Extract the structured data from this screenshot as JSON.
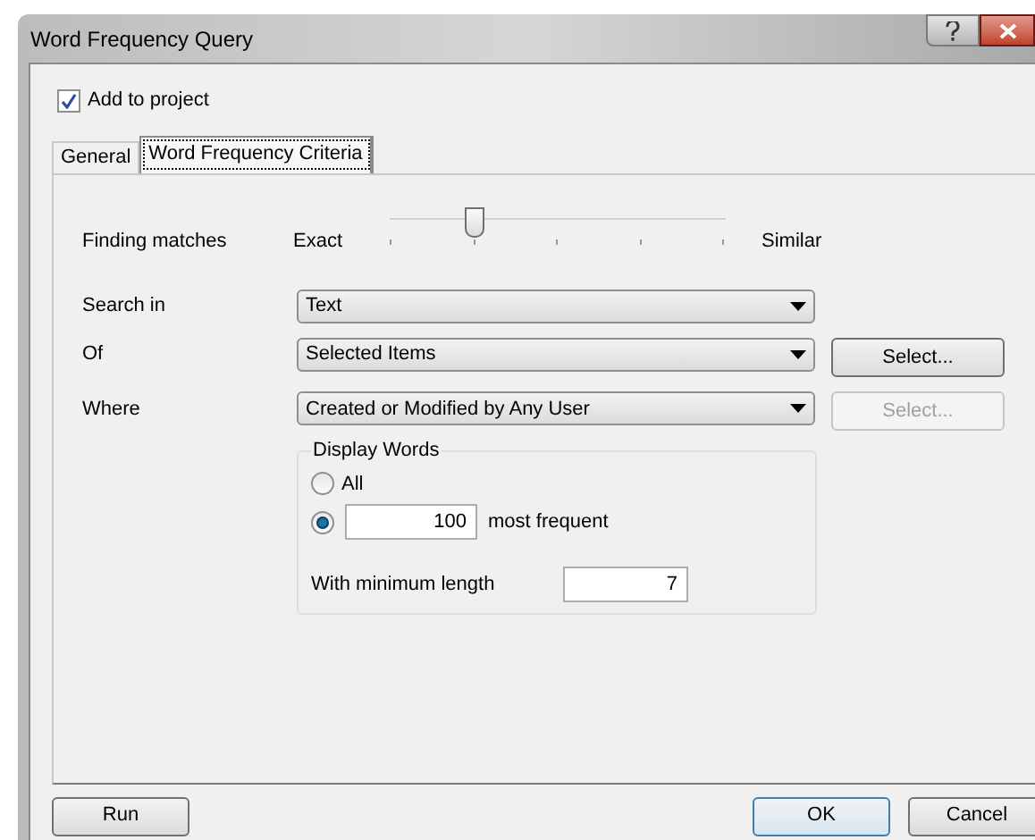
{
  "window": {
    "title": "Word Frequency Query"
  },
  "add_to_project": {
    "label": "Add to project",
    "checked": true
  },
  "tabs": [
    {
      "label": "General",
      "selected": false
    },
    {
      "label": "Word Frequency Criteria",
      "selected": true
    }
  ],
  "finding_matches": {
    "label": "Finding matches",
    "min_label": "Exact",
    "max_label": "Similar",
    "level": 0.25
  },
  "fields": [
    {
      "label": "Search in",
      "value": "Text"
    },
    {
      "label": "Of",
      "value": "Selected Items",
      "button": {
        "label": "Select...",
        "disabled": false
      }
    },
    {
      "label": "Where",
      "value": "Created or Modified by Any User",
      "button": {
        "label": "Select...",
        "disabled": true
      }
    }
  ],
  "display_words": {
    "title": "Display Words",
    "options": [
      {
        "kind": "plain",
        "label": "All",
        "selected": false
      },
      {
        "kind": "count",
        "value": "100",
        "label": "most frequent",
        "selected": true
      }
    ],
    "min_length": {
      "label": "With minimum length",
      "value": "7"
    }
  },
  "buttons": [
    {
      "label": "Run",
      "default": false
    },
    {
      "label": "OK",
      "default": true
    },
    {
      "label": "Cancel",
      "default": false
    }
  ]
}
